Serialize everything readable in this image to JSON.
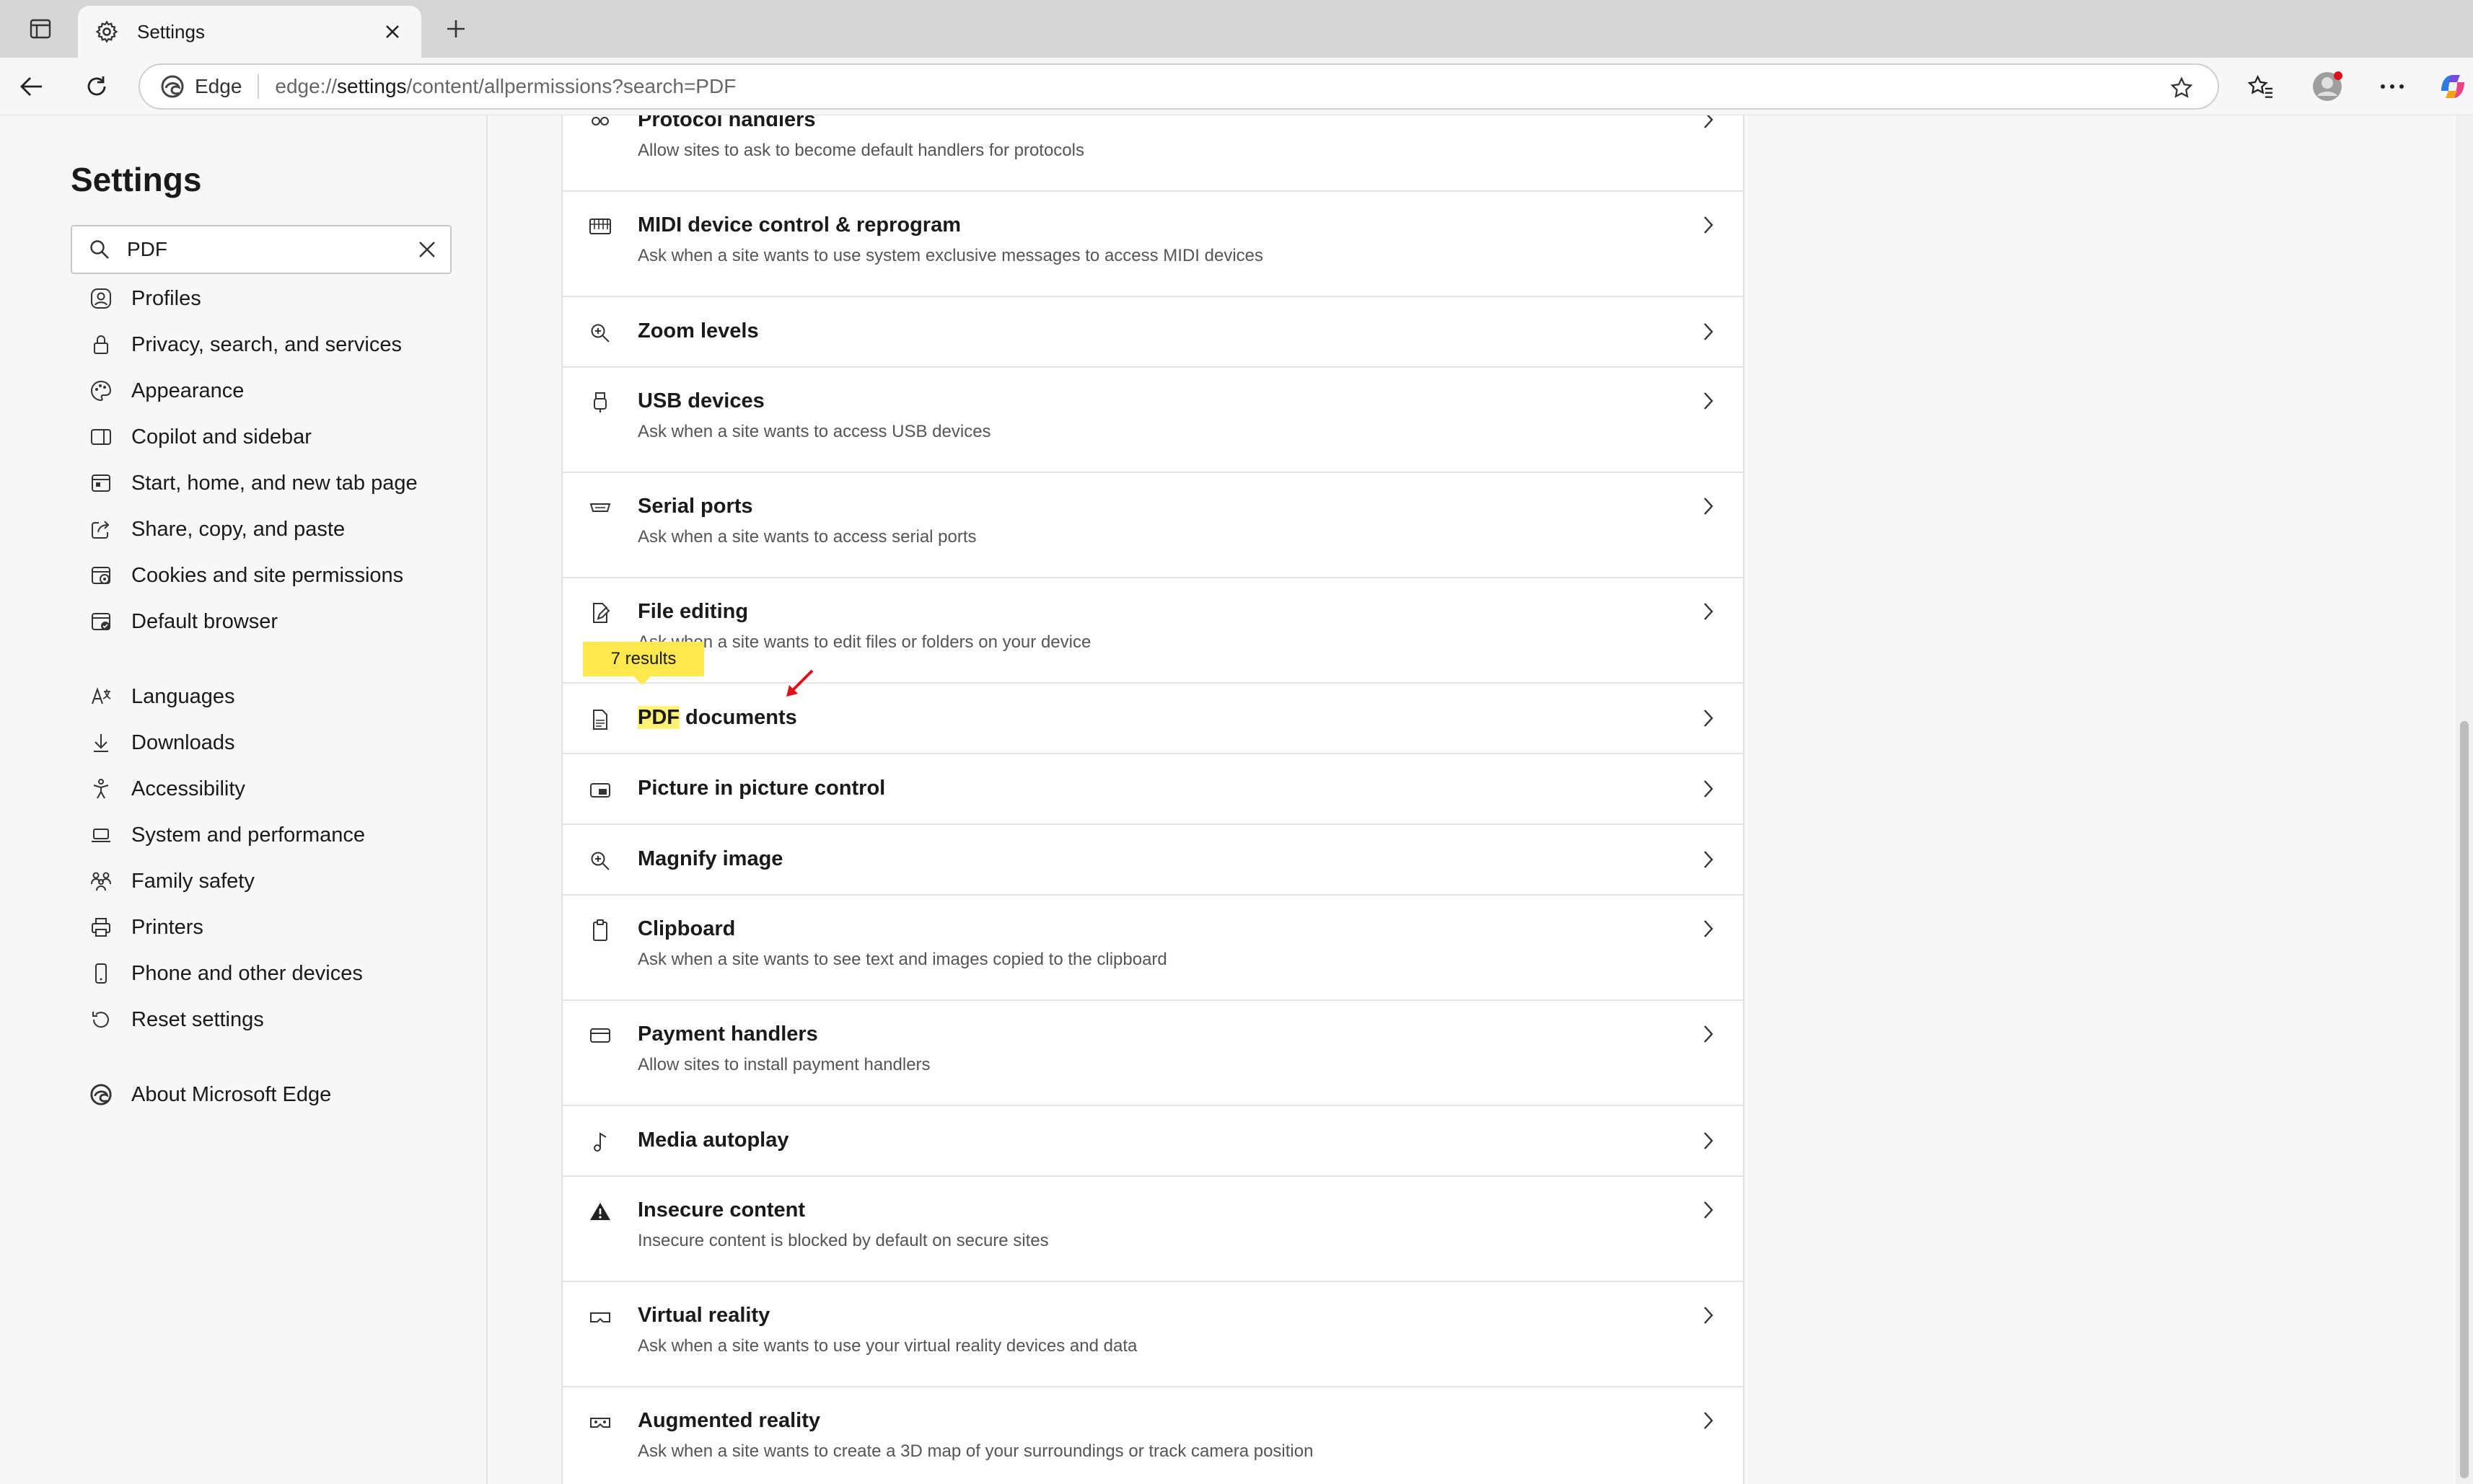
{
  "browser": {
    "tab_title": "Settings",
    "address_prefix": "Edge",
    "url_host": "edge://",
    "url_bold": "settings",
    "url_rest": "/content/allpermissions?search=PDF"
  },
  "sidebar": {
    "title": "Settings",
    "search_value": "PDF",
    "items": [
      {
        "label": "Profiles",
        "icon": "profile-icon"
      },
      {
        "label": "Privacy, search, and services",
        "icon": "lock-icon"
      },
      {
        "label": "Appearance",
        "icon": "palette-icon"
      },
      {
        "label": "Copilot and sidebar",
        "icon": "sidebar-icon"
      },
      {
        "label": "Start, home, and new tab page",
        "icon": "home-page-icon"
      },
      {
        "label": "Share, copy, and paste",
        "icon": "share-icon"
      },
      {
        "label": "Cookies and site permissions",
        "icon": "cookies-icon"
      },
      {
        "label": "Default browser",
        "icon": "default-browser-icon"
      },
      {
        "label": "Languages",
        "icon": "languages-icon"
      },
      {
        "label": "Downloads",
        "icon": "download-icon"
      },
      {
        "label": "Accessibility",
        "icon": "accessibility-icon"
      },
      {
        "label": "System and performance",
        "icon": "laptop-icon"
      },
      {
        "label": "Family safety",
        "icon": "family-icon"
      },
      {
        "label": "Printers",
        "icon": "printer-icon"
      },
      {
        "label": "Phone and other devices",
        "icon": "phone-icon"
      },
      {
        "label": "Reset settings",
        "icon": "reset-icon"
      },
      {
        "label": "About Microsoft Edge",
        "icon": "edge-logo-icon"
      }
    ]
  },
  "search_results_badge": "7 results",
  "permissions": [
    {
      "title": "Protocol handlers",
      "desc": "Allow sites to ask to become default handlers for protocols"
    },
    {
      "title": "MIDI device control & reprogram",
      "desc": "Ask when a site wants to use system exclusive messages to access MIDI devices"
    },
    {
      "title": "Zoom levels",
      "desc": ""
    },
    {
      "title": "USB devices",
      "desc": "Ask when a site wants to access USB devices"
    },
    {
      "title": "Serial ports",
      "desc": "Ask when a site wants to access serial ports"
    },
    {
      "title": "File editing",
      "desc": "Ask when a site wants to edit files or folders on your device"
    },
    {
      "title_highlight": "PDF",
      "title": " documents",
      "desc": ""
    },
    {
      "title": "Picture in picture control",
      "desc": ""
    },
    {
      "title": "Magnify image",
      "desc": ""
    },
    {
      "title": "Clipboard",
      "desc": "Ask when a site wants to see text and images copied to the clipboard"
    },
    {
      "title": "Payment handlers",
      "desc": "Allow sites to install payment handlers"
    },
    {
      "title": "Media autoplay",
      "desc": ""
    },
    {
      "title": "Insecure content",
      "desc": "Insecure content is blocked by default on secure sites"
    },
    {
      "title": "Virtual reality",
      "desc": "Ask when a site wants to use your virtual reality devices and data"
    },
    {
      "title": "Augmented reality",
      "desc": "Ask when a site wants to create a 3D map of your surroundings or track camera position"
    }
  ],
  "colors": {
    "highlight": "#fff176",
    "badge": "#fde84d",
    "annotation_arrow": "#e0101a"
  }
}
